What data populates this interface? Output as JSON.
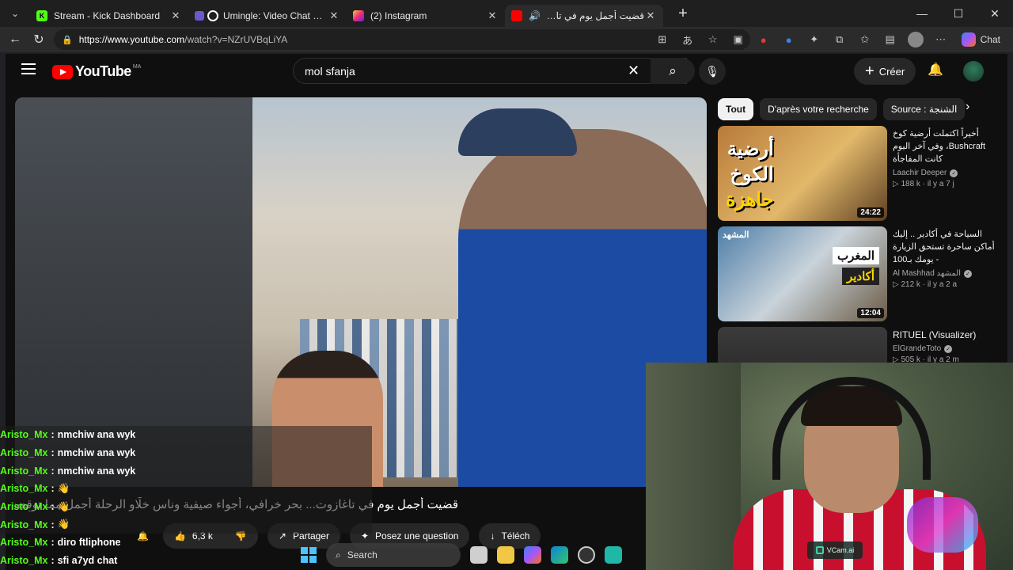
{
  "browser": {
    "tabs": [
      {
        "title": "Stream - Kick Dashboard",
        "fav": "K",
        "fav_color": "#53fc18"
      },
      {
        "title": "Umingle: Video Chat with Stra",
        "fav_color": "#6e56cf"
      },
      {
        "title": "(2) Instagram",
        "fav_color": "#e1306c"
      },
      {
        "title": "قضيت أجمل يوم في تاغازو",
        "fav_color": "#ff0000"
      }
    ],
    "url_host": "https://www.youtube.com",
    "url_path": "/watch?v=NZrUVBqLiYA",
    "chat_label": "Chat"
  },
  "youtube": {
    "logo_text": "YouTube",
    "country_code": "MA",
    "search_value": "mol sfanja",
    "create_label": "Créer",
    "chips": [
      "Tout",
      "D'après votre recherche",
      "Source : الشنجة"
    ],
    "recommendations": [
      {
        "title": "أخيراً اكتملت أرضية كوخ Bushcraft، وفي آخر اليوم كانت المفاجأة",
        "channel": "Laachir Deeper",
        "meta": "▷ 188 k · il y a 7 j",
        "duration": "24:22",
        "thumb_line1": "أرضية",
        "thumb_line2": "الكوخ",
        "thumb_line3": "جاهزة"
      },
      {
        "title": "السياحة في أكادير .. إليك أماكن ساحرة تستحق الزيارة - يومك بـ100",
        "channel": "Al Mashhad المشهد",
        "meta": "▷ 212 k · il y a 2 a",
        "duration": "12:04",
        "thumb_logo": "المشهد",
        "thumb_line1": "المغرب",
        "thumb_line2": "أكادير"
      },
      {
        "title": "RITUEL (Visualizer)",
        "channel": "ElGrandeToto",
        "meta": "▷ 505 k · il y a 2 m"
      }
    ],
    "video_title": "قضيت أجمل يوم في تاغازوت... بحر خرافي، أجواء صيفية وناس خلّاو الرحلة أجمل مما توقعت 😍",
    "actions": {
      "likes": "6,3 k",
      "share": "Partager",
      "ask": "Posez une question",
      "download": "Téléch"
    }
  },
  "chat": [
    {
      "user": "Aristo_Mx",
      "text": "nmchiw ana wyk"
    },
    {
      "user": "Aristo_Mx",
      "text": "nmchiw ana wyk"
    },
    {
      "user": "Aristo_Mx",
      "text": "nmchiw ana wyk"
    },
    {
      "user": "Aristo_Mx",
      "text": "👋"
    },
    {
      "user": "Aristo_Mx",
      "text": "👋"
    },
    {
      "user": "Aristo_Mx",
      "text": "👋"
    },
    {
      "user": "Aristo_Mx",
      "text": "diro ftliphone"
    },
    {
      "user": "Aristo_Mx",
      "text": "sfi a7yd chat"
    }
  ],
  "webcam": {
    "badge": "VCam.ai"
  },
  "taskbar": {
    "search_label": "Search"
  }
}
